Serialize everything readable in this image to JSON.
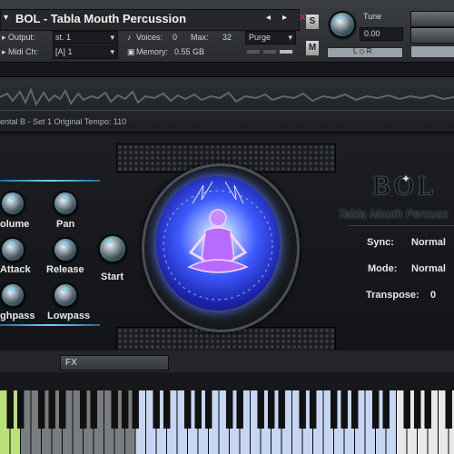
{
  "header": {
    "title": "BOL - Tabla Mouth Percussion",
    "output_label": "Output:",
    "output_value": "st. 1",
    "midi_label": "Midi Ch:",
    "midi_value": "[A] 1",
    "voices_label": "Voices:",
    "voices_value": "0",
    "max_label": "Max:",
    "max_value": "32",
    "purge_label": "Purge",
    "memory_label": "Memory:",
    "memory_value": "0.55 GB",
    "solo_label": "S",
    "mute_label": "M",
    "tune_label": "Tune",
    "tune_value": "0.00",
    "pan_center_label": "L ◇ R"
  },
  "wave": {
    "info": "ental B - Set 1   Original Tempo: 110"
  },
  "controls": {
    "volume": "olume",
    "pan": "Pan",
    "attack": "Attack",
    "release": "Release",
    "highpass": "ghpass",
    "lowpass": "Lowpass",
    "start": "Start"
  },
  "logo": {
    "name": "BOL",
    "subtitle": "Tabla Mouth Percuss"
  },
  "settings": {
    "sync_label": "Sync:",
    "sync_value": "Normal",
    "mode_label": "Mode:",
    "mode_value": "Normal",
    "transpose_label": "Transpose:",
    "transpose_value": "0"
  },
  "fx": {
    "tab_label": "FX"
  },
  "colors": {
    "accent": "#5fc4e6",
    "key_highlight": "#b9e07a",
    "key_blue": "#c6d6f2"
  }
}
